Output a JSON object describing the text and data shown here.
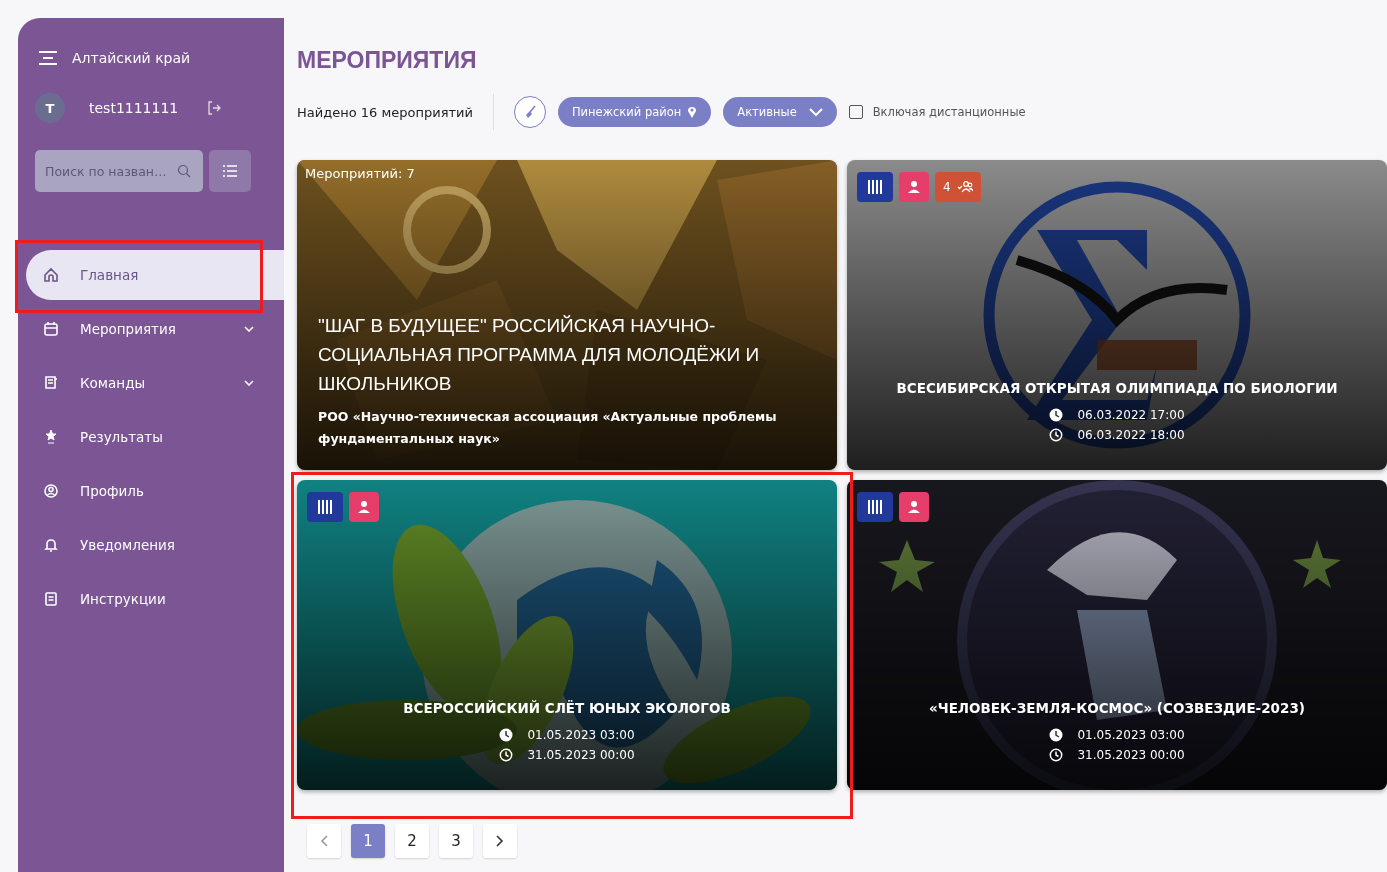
{
  "sidebar": {
    "region": "Алтайский край",
    "user": {
      "initial": "T",
      "name": "test1111111"
    },
    "search": {
      "placeholder": "Поиск по назван…"
    },
    "items": [
      {
        "label": "Главная",
        "selected": true,
        "expandable": false
      },
      {
        "label": "Мероприятия",
        "selected": false,
        "expandable": true
      },
      {
        "label": "Команды",
        "selected": false,
        "expandable": true
      },
      {
        "label": "Результаты",
        "selected": false,
        "expandable": false
      },
      {
        "label": "Профиль",
        "selected": false,
        "expandable": false
      },
      {
        "label": "Уведомления",
        "selected": false,
        "expandable": false
      },
      {
        "label": "Инструкции",
        "selected": false,
        "expandable": false
      }
    ]
  },
  "main": {
    "title": "МЕРОПРИЯТИЯ",
    "found": "Найдено 16 мероприятий",
    "filters": {
      "district": "Пинежский район",
      "status": "Активные",
      "remote": {
        "label": "Включая дистанционные",
        "checked": false
      }
    },
    "events": [
      {
        "kind": "group",
        "count": "Мероприятий: 7",
        "title": "\"ШАГ В БУДУЩЕЕ\" РОССИЙСКАЯ НАУЧНО-СОЦИАЛЬНАЯ ПРОГРАММА ДЛЯ МОЛОДЁЖИ И ШКОЛЬНИКОВ",
        "organizer": "РОО «Научно-техническая ассоциация «Актуальные проблемы фундаментальных наук»"
      },
      {
        "kind": "event",
        "badges": [
          {
            "kind": "stripes"
          },
          {
            "kind": "person"
          },
          {
            "kind": "teams",
            "text": "4"
          }
        ],
        "title": "ВСЕСИБИРСКАЯ ОТКРЫТАЯ ОЛИМПИАДА ПО БИОЛОГИИ",
        "start": "06.03.2022 17:00",
        "end": "06.03.2022 18:00"
      },
      {
        "kind": "event",
        "badges": [
          {
            "kind": "stripes"
          },
          {
            "kind": "person"
          }
        ],
        "title": "ВСЕРОССИЙСКИЙ СЛЁТ ЮНЫХ ЭКОЛОГОВ",
        "start": "01.05.2023 03:00",
        "end": "31.05.2023 00:00"
      },
      {
        "kind": "event",
        "badges": [
          {
            "kind": "stripes"
          },
          {
            "kind": "person"
          }
        ],
        "title": "«ЧЕЛОВЕК-ЗЕМЛЯ-КОСМОС» (СОЗВЕЗДИЕ-2023)",
        "start": "01.05.2023 03:00",
        "end": "31.05.2023 00:00"
      }
    ],
    "pages": [
      {
        "label": "1",
        "selected": true
      },
      {
        "label": "2",
        "selected": false
      },
      {
        "label": "3",
        "selected": false
      }
    ]
  }
}
